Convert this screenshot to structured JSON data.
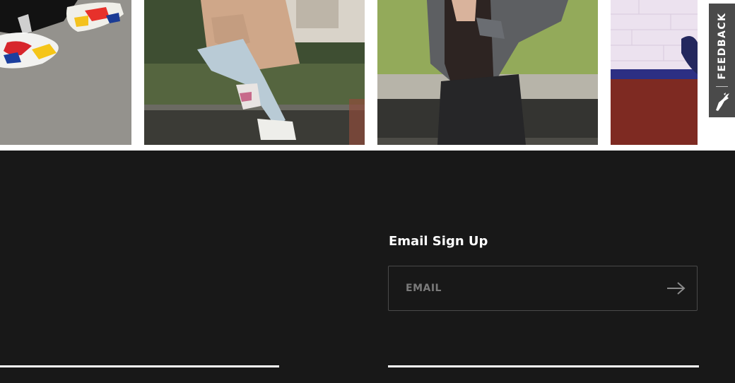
{
  "gallery": {
    "photos": [
      {
        "icon": "sneakers-on-pavement-photo"
      },
      {
        "icon": "person-sitting-on-ledge-photo"
      },
      {
        "icon": "person-on-bench-photo"
      },
      {
        "icon": "skateboarder-photo"
      }
    ]
  },
  "feedback_tab": {
    "label": "FEEDBACK",
    "icon": "puma-logo-icon",
    "background": "#4a4a4a"
  },
  "footer": {
    "background": "#181818",
    "email_signup": {
      "title": "Email Sign Up",
      "placeholder": "EMAIL",
      "value": "",
      "submit_icon": "arrow-right-icon"
    }
  }
}
